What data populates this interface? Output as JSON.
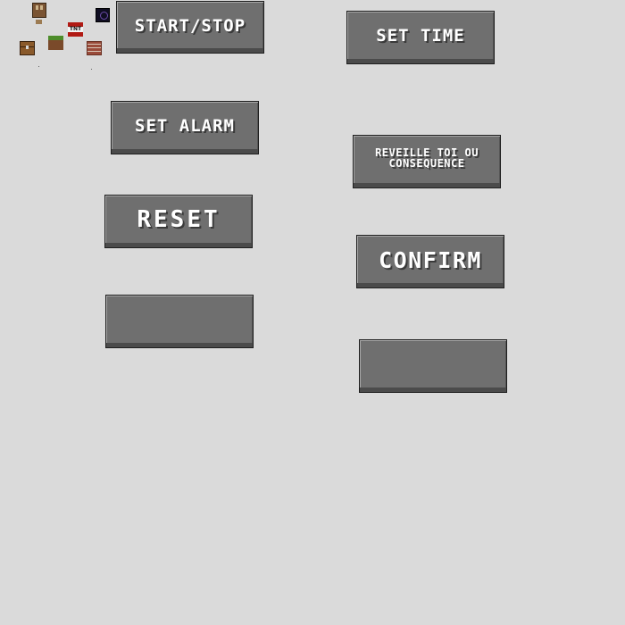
{
  "buttons": {
    "start_stop": "START/STOP",
    "set_time": "SET TIME",
    "set_alarm": "SET ALARM",
    "reveille_line1": "REVEILLE TOI OU",
    "reveille_line2": "CONSEQUENCE",
    "reset": "RESET",
    "confirm": "CONFIRM",
    "blank1": "",
    "blank2": ""
  },
  "icons": [
    "door-icon",
    "ender-pearl-icon",
    "tnt-block-icon",
    "grass-block-icon",
    "chest-icon",
    "brick-block-icon"
  ],
  "tnt_label": "TNT",
  "colors": {
    "background": "#dadada",
    "button_face": "#6f6f6f",
    "button_text": "#ffffff"
  }
}
